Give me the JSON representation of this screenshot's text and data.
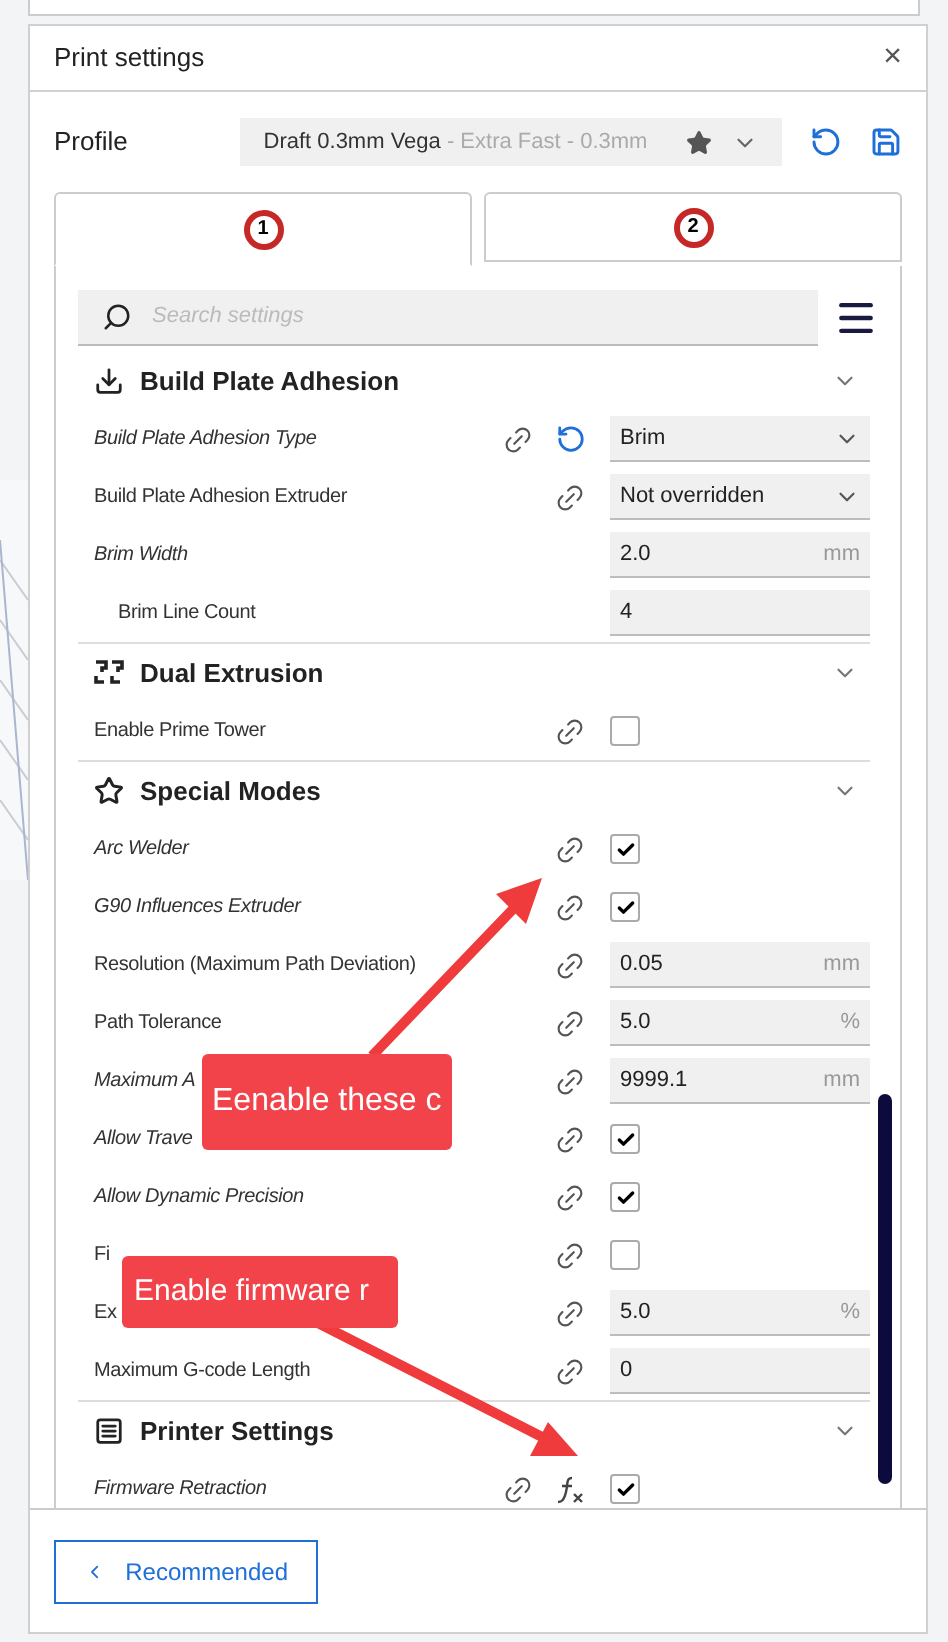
{
  "window": {
    "title": "Print settings",
    "close": "×"
  },
  "profile": {
    "label": "Profile",
    "name": "Draft 0.3mm Vega",
    "detail": " - Extra Fast - 0.3mm"
  },
  "tabs": [
    {
      "badge": "1",
      "selected": true
    },
    {
      "badge": "2",
      "selected": false
    }
  ],
  "search": {
    "placeholder": "Search settings"
  },
  "sections": [
    {
      "title": "Build Plate Adhesion",
      "expanded": true,
      "rows": [
        {
          "kind": "dropdown",
          "label": "Build Plate Adhesion Type",
          "italic": true,
          "linked": true,
          "reset": true,
          "formula": false,
          "value": "Brim"
        },
        {
          "kind": "dropdown",
          "label": "Build Plate Adhesion Extruder",
          "italic": false,
          "linked": true,
          "reset": false,
          "formula": false,
          "value": "Not overridden"
        },
        {
          "kind": "input",
          "label": "Brim Width",
          "italic": true,
          "linked": false,
          "reset": false,
          "formula": false,
          "value": "2.0",
          "unit": "mm",
          "children": [
            {
              "kind": "input",
              "label": "Brim Line Count",
              "italic": false,
              "linked": false,
              "reset": false,
              "formula": false,
              "value": "4"
            }
          ]
        }
      ]
    },
    {
      "title": "Dual Extrusion",
      "expanded": true,
      "rows": [
        {
          "kind": "checkbox",
          "label": "Enable Prime Tower",
          "italic": false,
          "linked": true,
          "reset": false,
          "formula": false,
          "checked": false
        }
      ]
    },
    {
      "title": "Special Modes",
      "expanded": true,
      "rows": [
        {
          "kind": "checkbox",
          "label": "Arc Welder",
          "italic": true,
          "linked": true,
          "reset": false,
          "formula": false,
          "checked": true
        },
        {
          "kind": "checkbox",
          "label": "G90 Influences Extruder",
          "italic": true,
          "linked": true,
          "reset": false,
          "formula": false,
          "checked": true
        },
        {
          "kind": "input",
          "label": "Resolution (Maximum Path Deviation)",
          "italic": false,
          "linked": true,
          "reset": false,
          "formula": false,
          "value": "0.05",
          "unit": "mm"
        },
        {
          "kind": "input",
          "label": "Path Tolerance",
          "italic": false,
          "linked": true,
          "reset": false,
          "formula": false,
          "value": "5.0",
          "unit": "%"
        },
        {
          "kind": "input",
          "label": "Maximum A",
          "italic": true,
          "linked": true,
          "reset": false,
          "formula": false,
          "value": "9999.1",
          "unit": "mm"
        },
        {
          "kind": "checkbox",
          "label": "Allow Trave",
          "italic": true,
          "linked": true,
          "reset": false,
          "formula": false,
          "checked": true
        },
        {
          "kind": "checkbox",
          "label": "Allow Dynamic Precision",
          "italic": true,
          "linked": true,
          "reset": false,
          "formula": false,
          "checked": true
        },
        {
          "kind": "checkbox",
          "label": "Fi",
          "italic": false,
          "linked": true,
          "reset": false,
          "formula": false,
          "checked": false
        },
        {
          "kind": "input",
          "label": "Ex",
          "italic": false,
          "linked": true,
          "reset": false,
          "formula": false,
          "value": "5.0",
          "unit": "%"
        },
        {
          "kind": "input",
          "label": "Maximum G-code Length",
          "italic": false,
          "linked": true,
          "reset": false,
          "formula": false,
          "value": "0"
        }
      ]
    },
    {
      "title": "Printer Settings",
      "expanded": true,
      "rows": [
        {
          "kind": "checkbox",
          "label": "Firmware Retraction",
          "italic": true,
          "linked": true,
          "reset": false,
          "formula": true,
          "checked": true
        }
      ]
    }
  ],
  "callouts": [
    {
      "text": "Eenable these c"
    },
    {
      "text": "Enable firmware r"
    }
  ],
  "footer": {
    "button": "Recommended"
  }
}
